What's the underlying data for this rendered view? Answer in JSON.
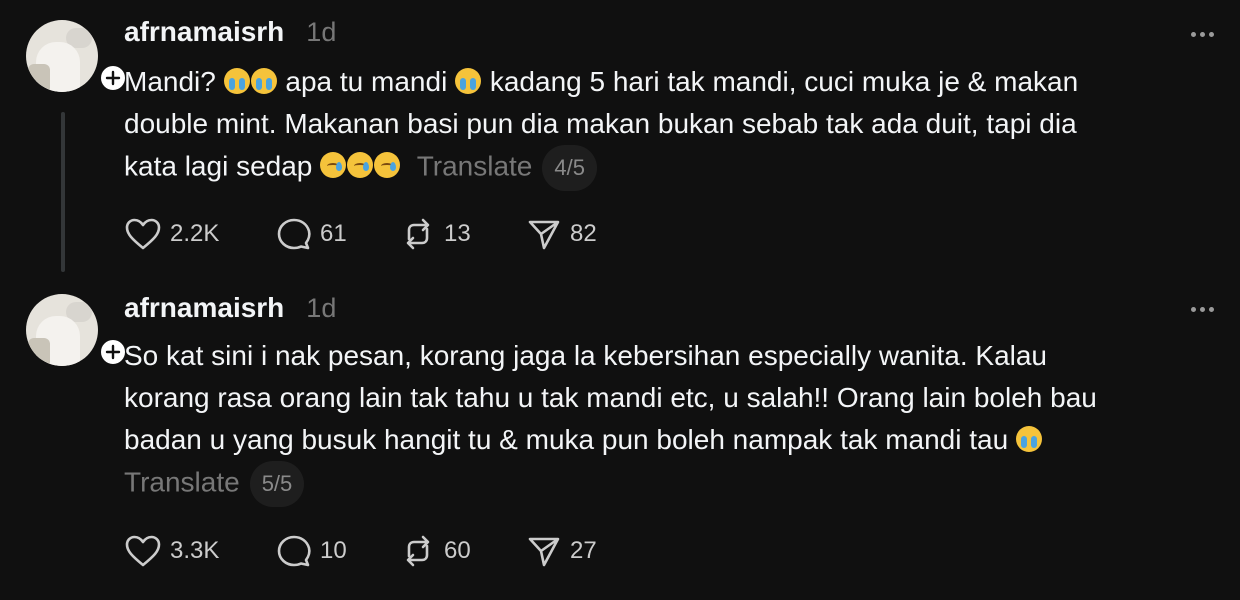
{
  "posts": [
    {
      "username": "afrnamaisrh",
      "time": "1d",
      "text_line1": "Mandi?",
      "text_line1b": "apa tu mandi",
      "text_line1c": "kadang 5 hari tak mandi, cuci muka je & makan",
      "text_line2": "double mint. Makanan basi pun dia makan bukan sebab tak ada duit, tapi dia",
      "text_line3": "kata lagi sedap",
      "translate": "Translate",
      "page": "4/5",
      "likes": "2.2K",
      "replies": "61",
      "reposts": "13",
      "shares": "82"
    },
    {
      "username": "afrnamaisrh",
      "time": "1d",
      "text_line1": "So kat sini i nak pesan, korang jaga la kebersihan especially wanita. Kalau",
      "text_line2": "korang rasa orang lain tak tahu u tak mandi etc, u salah!! Orang lain boleh bau",
      "text_line3": "badan u yang busuk hangit tu & muka pun boleh nampak tak mandi tau",
      "translate": "Translate",
      "page": "5/5",
      "likes": "3.3K",
      "replies": "10",
      "reposts": "60",
      "shares": "27"
    }
  ],
  "icons": [
    "avatar",
    "follow-plus-icon",
    "more-options-icon",
    "heart-icon",
    "comment-icon",
    "repost-icon",
    "share-icon",
    "loudly-crying-emoji",
    "face-holding-back-tears-emoji"
  ],
  "colors": {
    "background": "#101010",
    "text": "#f3f5f7",
    "muted": "#777777"
  }
}
